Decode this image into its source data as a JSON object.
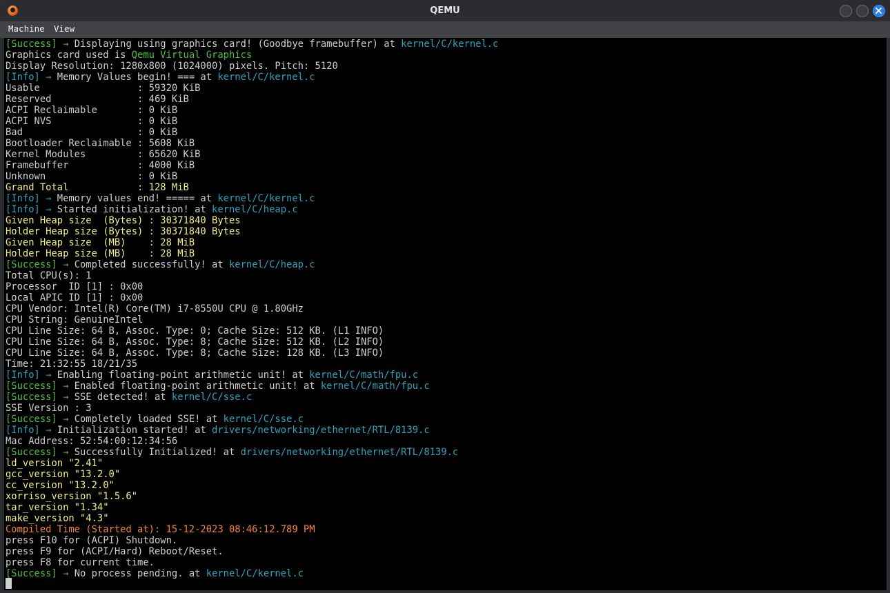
{
  "window": {
    "title": "QEMU"
  },
  "menubar": {
    "machine": "Machine",
    "view": "View"
  },
  "colors": {
    "white": "#cfcfcf",
    "green": "#4ebf3f",
    "cyan": "#2fa3ba",
    "yellow": "#f2ee8a",
    "orange": "#f2853c"
  },
  "console": {
    "lines": [
      [
        [
          "g",
          "[Success] → "
        ],
        [
          "w",
          "Displaying using graphics card! (Goodbye framebuffer) at "
        ],
        [
          "c",
          "kernel/C/kernel.c"
        ]
      ],
      [
        [
          "w",
          "Graphics card used is "
        ],
        [
          "g",
          "Qemu Virtual Graphics"
        ]
      ],
      [
        [
          "w",
          "Display Resolution: 1280x800 (1024000) pixels. Pitch: 5120"
        ]
      ],
      [
        [
          "c",
          "[Info] → "
        ],
        [
          "w",
          "Memory Values begin! === at "
        ],
        [
          "c",
          "kernel/C/kernel.c"
        ]
      ],
      [
        [
          "w",
          "Usable                 : 59320 KiB"
        ]
      ],
      [
        [
          "w",
          "Reserved               : 469 KiB"
        ]
      ],
      [
        [
          "w",
          "ACPI Reclaimable       : 0 KiB"
        ]
      ],
      [
        [
          "w",
          "ACPI NVS               : 0 KiB"
        ]
      ],
      [
        [
          "w",
          "Bad                    : 0 KiB"
        ]
      ],
      [
        [
          "w",
          "Bootloader Reclaimable : 5608 KiB"
        ]
      ],
      [
        [
          "w",
          "Kernel Modules         : 65620 KiB"
        ]
      ],
      [
        [
          "w",
          "Framebuffer            : 4000 KiB"
        ]
      ],
      [
        [
          "w",
          "Unknown                : 0 KiB"
        ]
      ],
      [
        [
          "y",
          "Grand Total            : 128 MiB"
        ]
      ],
      [
        [
          "c",
          "[Info] → "
        ],
        [
          "w",
          "Memory values end! ===== at "
        ],
        [
          "c",
          "kernel/C/kernel.c"
        ]
      ],
      [
        [
          "c",
          "[Info] → "
        ],
        [
          "w",
          "Started initialization! at "
        ],
        [
          "c",
          "kernel/C/heap.c"
        ]
      ],
      [
        [
          "y",
          "Given Heap size  (Bytes) : 30371840 Bytes"
        ]
      ],
      [
        [
          "y",
          "Holder Heap size (Bytes) : 30371840 Bytes"
        ]
      ],
      [
        [
          "y",
          "Given Heap size  (MB)    : 28 MiB"
        ]
      ],
      [
        [
          "y",
          "Holder Heap size (MB)    : 28 MiB"
        ]
      ],
      [
        [
          "g",
          "[Success] → "
        ],
        [
          "w",
          "Completed successfully! at "
        ],
        [
          "c",
          "kernel/C/heap.c"
        ]
      ],
      [
        [
          "w",
          "Total CPU(s): 1"
        ]
      ],
      [
        [
          "w",
          "Processor  ID [1] : 0x00"
        ]
      ],
      [
        [
          "w",
          "Local APIC ID [1] : 0x00"
        ]
      ],
      [
        [
          "w",
          "CPU Vendor: Intel(R) Core(TM) i7-8550U CPU @ 1.80GHz"
        ]
      ],
      [
        [
          "w",
          "CPU String: GenuineIntel"
        ]
      ],
      [
        [
          "w",
          "CPU Line Size: 64 B, Assoc. Type: 0; Cache Size: 512 KB. (L1 INFO)"
        ]
      ],
      [
        [
          "w",
          "CPU Line Size: 64 B, Assoc. Type: 8; Cache Size: 512 KB. (L2 INFO)"
        ]
      ],
      [
        [
          "w",
          "CPU Line Size: 64 B, Assoc. Type: 8; Cache Size: 128 KB. (L3 INFO)"
        ]
      ],
      [
        [
          "w",
          "Time: 21:32:55 18/21/35"
        ]
      ],
      [
        [
          "c",
          "[Info] → "
        ],
        [
          "w",
          "Enabling floating-point arithmetic unit! at "
        ],
        [
          "c",
          "kernel/C/math/fpu.c"
        ]
      ],
      [
        [
          "g",
          "[Success] → "
        ],
        [
          "w",
          "Enabled floating-point arithmetic unit! at "
        ],
        [
          "c",
          "kernel/C/math/fpu.c"
        ]
      ],
      [
        [
          "g",
          "[Success] → "
        ],
        [
          "w",
          "SSE detected! at "
        ],
        [
          "c",
          "kernel/C/sse.c"
        ]
      ],
      [
        [
          "w",
          "SSE Version : 3"
        ]
      ],
      [
        [
          "g",
          "[Success] → "
        ],
        [
          "w",
          "Completely loaded SSE! at "
        ],
        [
          "c",
          "kernel/C/sse.c"
        ]
      ],
      [
        [
          "c",
          "[Info] → "
        ],
        [
          "w",
          "Initialization started! at "
        ],
        [
          "c",
          "drivers/networking/ethernet/RTL/8139.c"
        ]
      ],
      [
        [
          "w",
          "Mac Address: 52:54:00:12:34:56"
        ]
      ],
      [
        [
          "g",
          "[Success] → "
        ],
        [
          "w",
          "Successfully Initialized! at "
        ],
        [
          "c",
          "drivers/networking/ethernet/RTL/8139.c"
        ]
      ],
      [
        [
          "y",
          "ld_version \"2.41\""
        ]
      ],
      [
        [
          "y",
          "gcc_version \"13.2.0\""
        ]
      ],
      [
        [
          "y",
          "cc_version \"13.2.0\""
        ]
      ],
      [
        [
          "y",
          "xorriso_version \"1.5.6\""
        ]
      ],
      [
        [
          "y",
          "tar_version \"1.34\""
        ]
      ],
      [
        [
          "y",
          "make_version \"4.3\""
        ]
      ],
      [
        [
          "o",
          "Compiled Time (Started at): 15-12-2023 08:46:12.789 PM"
        ]
      ],
      [
        [
          "w",
          "press F10 for (ACPI) Shutdown."
        ]
      ],
      [
        [
          "w",
          "press F9 for (ACPI/Hard) Reboot/Reset."
        ]
      ],
      [
        [
          "w",
          "press F8 for current time."
        ]
      ],
      [
        [
          "g",
          "[Success] → "
        ],
        [
          "w",
          "No process pending. at "
        ],
        [
          "c",
          "kernel/C/kernel.c"
        ]
      ]
    ]
  }
}
